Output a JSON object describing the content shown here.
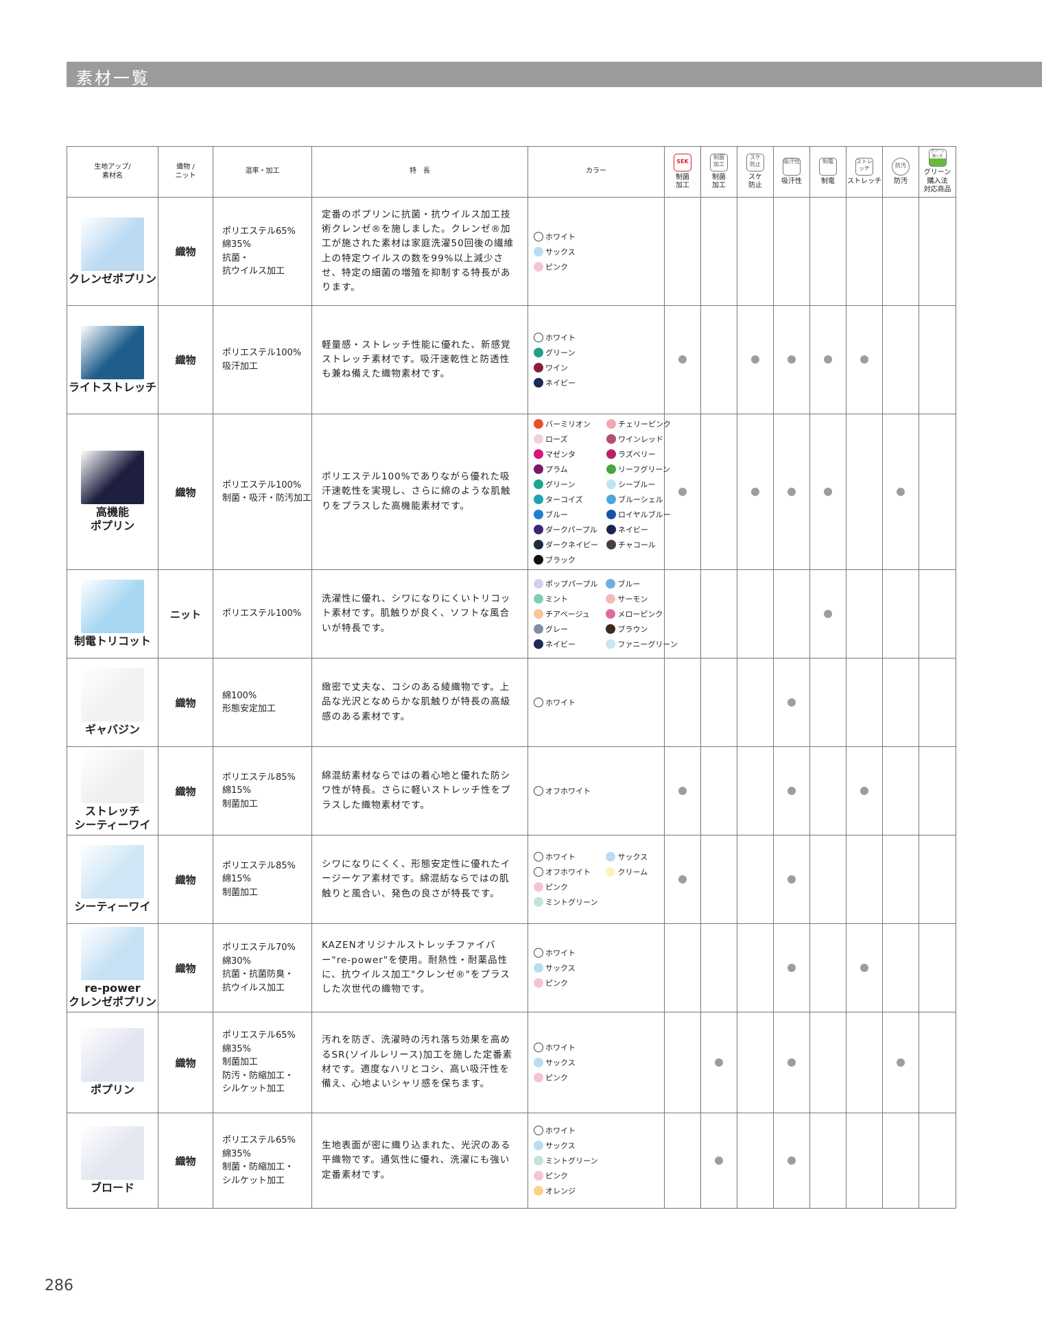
{
  "title": "素材一覧",
  "page_number": "286",
  "headers": {
    "fabric": "生地アップ/\n素材名",
    "type": "織物 /\nニット",
    "composition": "混率・加工",
    "features": "特　長",
    "colors": "カラー",
    "functions": [
      {
        "icon": "sek-icon",
        "icon_text": "SEK",
        "label": "制菌\n加工"
      },
      {
        "icon": "antibacterial-icon",
        "icon_text": "制菌\n加工",
        "label": "制菌\n加工"
      },
      {
        "icon": "see-through-icon",
        "icon_text": "スケ\n防止",
        "label": "スケ\n防止"
      },
      {
        "icon": "sweat-absorb-icon",
        "icon_text": "吸汗性",
        "label": "吸汗性"
      },
      {
        "icon": "antistatic-icon",
        "icon_text": "制電",
        "label": "制電"
      },
      {
        "icon": "stretch-icon",
        "icon_text": "ストレッチ",
        "label": "ストレッチ"
      },
      {
        "icon": "stain-proof-icon",
        "icon_text": "防汚",
        "label": "防汚"
      },
      {
        "icon": "green-purchase-icon",
        "icon_text": "グリーン購入法",
        "label": "グリーン\n購入法\n対応商品"
      }
    ]
  },
  "rows": [
    {
      "name": "クレンゼポプリン",
      "swatch": "#bcdaf2",
      "type": "織物",
      "composition": "ポリエステル65%\n綿35%\n抗菌・\n抗ウイルス加工",
      "features": "定番のポプリンに抗菌・抗ウイルス加工技術クレンゼ®を施しました。クレンゼ®加工が施された素材は家庭洗濯50回後の繊維上の特定ウイルスの数を99%以上減少させ、特定の細菌の増殖を抑制する特長があります。",
      "cols": 1,
      "colors": [
        {
          "name": "ホワイト",
          "hex": "#ffffff"
        },
        {
          "name": "サックス",
          "hex": "#b9dcf3"
        },
        {
          "name": "ピンク",
          "hex": "#f6c3d8"
        }
      ],
      "marks": [
        false,
        false,
        false,
        false,
        false,
        false,
        false,
        false
      ]
    },
    {
      "name": "ライトストレッチ",
      "swatch": "#1f5d8c",
      "type": "織物",
      "composition": "ポリエステル100%\n吸汗加工",
      "features": "軽量感・ストレッチ性能に優れた、新感覚ストレッチ素材です。吸汗速乾性と防透性も兼ね備えた織物素材です。",
      "cols": 1,
      "colors": [
        {
          "name": "ホワイト",
          "hex": "#ffffff"
        },
        {
          "name": "グリーン",
          "hex": "#1fa08c"
        },
        {
          "name": "ワイン",
          "hex": "#8a1c3c"
        },
        {
          "name": "ネイビー",
          "hex": "#1c2a55"
        }
      ],
      "marks": [
        true,
        false,
        true,
        true,
        true,
        true,
        false,
        false
      ]
    },
    {
      "name": "高機能\nポプリン",
      "swatch": "#1e1f3f",
      "type": "織物",
      "composition": "ポリエステル100%\n制菌・吸汗・防汚加工",
      "features": "ポリエステル100%でありながら優れた吸汗速乾性を実現し、さらに綿のような肌触りをプラスした高機能素材です。",
      "cols": 2,
      "colors": [
        {
          "name": "バーミリオン",
          "hex": "#e8502c"
        },
        {
          "name": "チェリーピンク",
          "hex": "#f2a6b3"
        },
        {
          "name": "ローズ",
          "hex": "#f1d0e0"
        },
        {
          "name": "ワインレッド",
          "hex": "#b2506a"
        },
        {
          "name": "マゼンタ",
          "hex": "#d6157d"
        },
        {
          "name": "ラズベリー",
          "hex": "#b8226a"
        },
        {
          "name": "プラム",
          "hex": "#7a1a68"
        },
        {
          "name": "リーフグリーン",
          "hex": "#49a53c"
        },
        {
          "name": "グリーン",
          "hex": "#1ea58f"
        },
        {
          "name": "シーブルー",
          "hex": "#bfe3f3"
        },
        {
          "name": "ターコイズ",
          "hex": "#1fa2b2"
        },
        {
          "name": "ブルーシェル",
          "hex": "#4fa6dc"
        },
        {
          "name": "ブルー",
          "hex": "#1e7fcf"
        },
        {
          "name": "ロイヤルブルー",
          "hex": "#1654a8"
        },
        {
          "name": "ダークパープル",
          "hex": "#3e2478"
        },
        {
          "name": "ネイビー",
          "hex": "#1c2550"
        },
        {
          "name": "ダークネイビー",
          "hex": "#202a3e"
        },
        {
          "name": "チャコール",
          "hex": "#4a4044"
        },
        {
          "name": "ブラック",
          "hex": "#111111"
        }
      ],
      "marks": [
        true,
        false,
        true,
        true,
        true,
        false,
        true,
        false
      ]
    },
    {
      "name": "制電トリコット",
      "swatch": "#a8d6f2",
      "type": "ニット",
      "composition": "ポリエステル100%",
      "features": "洗濯性に優れ、シワになりにくいトリコット素材です。肌触りが良く、ソフトな風合いが特長です。",
      "cols": 2,
      "colors": [
        {
          "name": "ポップパープル",
          "hex": "#d7cdea"
        },
        {
          "name": "ブルー",
          "hex": "#6aaedc"
        },
        {
          "name": "ミント",
          "hex": "#7fcfb6"
        },
        {
          "name": "サーモン",
          "hex": "#f6b9b9"
        },
        {
          "name": "チアベージュ",
          "hex": "#f7c49a"
        },
        {
          "name": "メローピンク",
          "hex": "#e06a9c"
        },
        {
          "name": "グレー",
          "hex": "#7f8fa6"
        },
        {
          "name": "ブラウン",
          "hex": "#3a2a22"
        },
        {
          "name": "ネイビー",
          "hex": "#1b2a5a"
        },
        {
          "name": "ファニーグリーン",
          "hex": "#c8e6f0"
        }
      ],
      "marks": [
        false,
        false,
        false,
        false,
        true,
        false,
        false,
        false
      ]
    },
    {
      "name": "ギャバジン",
      "swatch": "#f0f1f3",
      "type": "織物",
      "composition": "綿100%\n形態安定加工",
      "features": "緻密で丈夫な、コシのある綾織物です。上品な光沢となめらかな肌触りが特長の高級感のある素材です。",
      "cols": 1,
      "colors": [
        {
          "name": "ホワイト",
          "hex": "#ffffff"
        }
      ],
      "marks": [
        false,
        false,
        false,
        true,
        false,
        false,
        false,
        false
      ]
    },
    {
      "name": "ストレッチ\nシーティーワイ",
      "swatch": "#eef1ee",
      "type": "織物",
      "composition": "ポリエステル85%\n綿15%\n制菌加工",
      "features": "綿混紡素材ならではの着心地と優れた防シワ性が特長。さらに軽いストレッチ性をプラスした織物素材です。",
      "cols": 1,
      "colors": [
        {
          "name": "オフホワイト",
          "hex": "#ffffff"
        }
      ],
      "marks": [
        true,
        false,
        false,
        true,
        false,
        true,
        false,
        false
      ]
    },
    {
      "name": "シーティーワイ",
      "swatch": "#cfe6f6",
      "type": "織物",
      "composition": "ポリエステル85%\n綿15%\n制菌加工",
      "features": "シワになりにくく、形態安定性に優れたイージーケア素材です。綿混紡ならではの肌触りと風合い、発色の良さが特長です。",
      "cols": 2,
      "colors": [
        {
          "name": "ホワイト",
          "hex": "#ffffff"
        },
        {
          "name": "サックス",
          "hex": "#b9dcf3"
        },
        {
          "name": "オフホワイト",
          "hex": "#ffffff"
        },
        {
          "name": "クリーム",
          "hex": "#fbf1c4"
        },
        {
          "name": "ピンク",
          "hex": "#f6c3d8"
        },
        {
          "name": "",
          "hex": ""
        },
        {
          "name": "ミントグリーン",
          "hex": "#bfe6d8"
        }
      ],
      "marks": [
        true,
        false,
        false,
        true,
        false,
        false,
        false,
        false
      ]
    },
    {
      "name": "re-power\nクレンゼポプリン",
      "swatch": "#c8e2f5",
      "type": "織物",
      "composition": "ポリエステル70%\n綿30%\n抗菌・抗菌防臭・\n抗ウイルス加工",
      "features": "KAZENオリジナルストレッチファイバー\"re-power\"を使用。耐熱性・耐薬品性に、抗ウイルス加工\"クレンゼ®\"をプラスした次世代の織物です。",
      "cols": 1,
      "colors": [
        {
          "name": "ホワイト",
          "hex": "#ffffff"
        },
        {
          "name": "サックス",
          "hex": "#b9dcf3"
        },
        {
          "name": "ピンク",
          "hex": "#f6c3d8"
        }
      ],
      "marks": [
        false,
        false,
        false,
        true,
        false,
        true,
        false,
        false
      ]
    },
    {
      "name": "ポプリン",
      "swatch": "#e2e4f2",
      "type": "織物",
      "composition": "ポリエステル65%\n綿35%\n制菌加工\n防汚・防縮加工・\nシルケット加工",
      "features": "汚れを防ぎ、洗濯時の汚れ落ち効果を高めるSR(ソイルレリース)加工を施した定番素材です。適度なハリとコシ、高い吸汗性を備え、心地よいシャリ感を保ちます。",
      "cols": 1,
      "colors": [
        {
          "name": "ホワイト",
          "hex": "#ffffff"
        },
        {
          "name": "サックス",
          "hex": "#b9dcf3"
        },
        {
          "name": "ピンク",
          "hex": "#f6c3d8"
        }
      ],
      "marks": [
        false,
        true,
        false,
        true,
        false,
        false,
        true,
        false
      ]
    },
    {
      "name": "ブロード",
      "swatch": "#e4e6f0",
      "type": "織物",
      "composition": "ポリエステル65%\n綿35%\n制菌・防縮加工・\nシルケット加工",
      "features": "生地表面が密に織り込まれた、光沢のある平織物です。通気性に優れ、洗濯にも強い定番素材です。",
      "cols": 1,
      "colors": [
        {
          "name": "ホワイト",
          "hex": "#ffffff"
        },
        {
          "name": "サックス",
          "hex": "#b9dcf3"
        },
        {
          "name": "ミントグリーン",
          "hex": "#bfe6d8"
        },
        {
          "name": "ピンク",
          "hex": "#f6c3d8"
        },
        {
          "name": "オレンジ",
          "hex": "#fbd08c"
        }
      ],
      "marks": [
        false,
        true,
        false,
        true,
        false,
        false,
        false,
        false
      ]
    }
  ]
}
